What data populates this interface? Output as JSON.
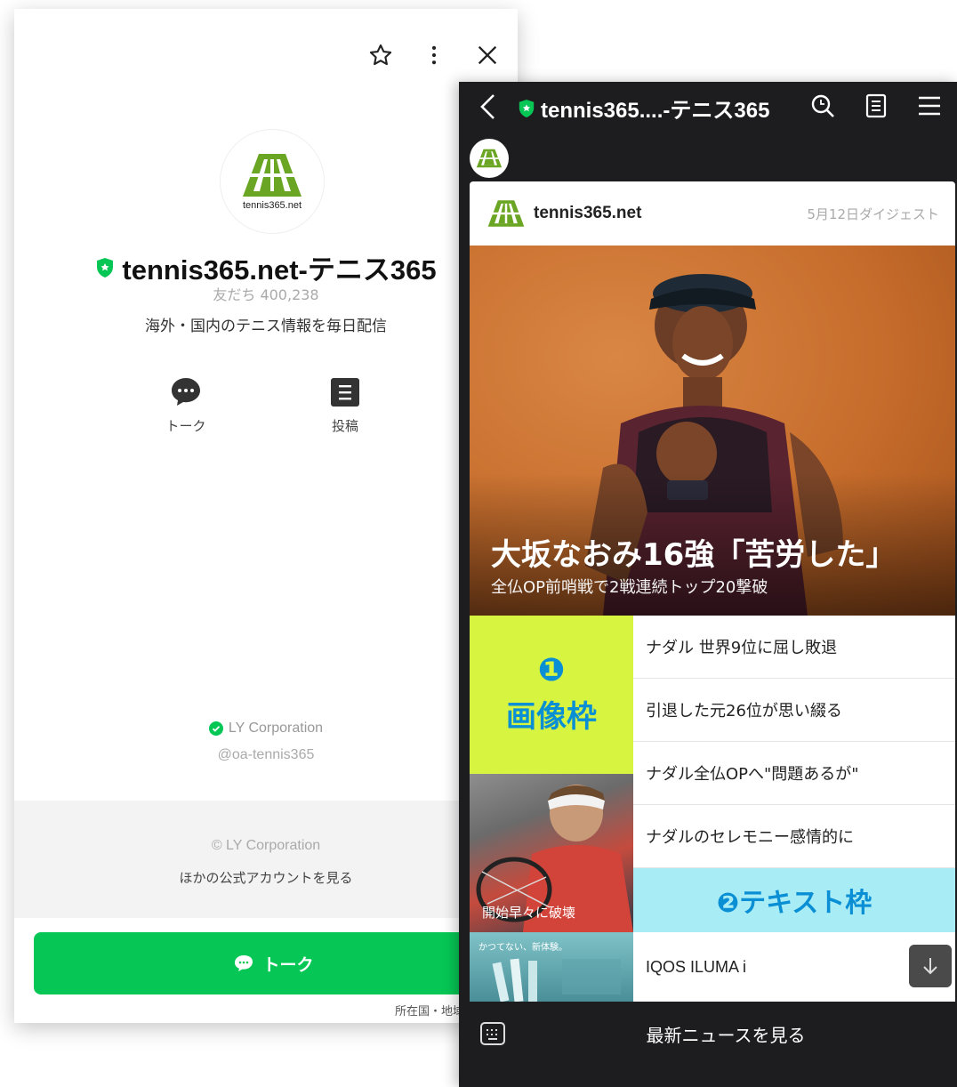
{
  "profile": {
    "logo_text": "tennis365.net",
    "name": "tennis365.net-テニス365",
    "friends": "友だち 400,238",
    "description": "海外・国内のテニス情報を毎日配信",
    "actions": [
      {
        "label": "トーク",
        "icon": "chat-bubble-icon"
      },
      {
        "label": "投稿",
        "icon": "post-list-icon"
      }
    ],
    "provider": "LY Corporation",
    "handle": "@oa-tennis365",
    "copyright": "© LY Corporation",
    "other_accounts": "ほかの公式アカウントを見る",
    "talk_button": "トーク",
    "region_link": "所在国・地域"
  },
  "chat": {
    "title": "tennis365....-テニス365",
    "digest": {
      "brand": "tennis365.net",
      "date": "5月12日ダイジェスト",
      "headline": "大坂なおみ16強「苦労した」",
      "subline": "全仏OP前哨戦で2戦連続トップ20撃破"
    },
    "image_frame": {
      "number": "❶",
      "label": "画像枠"
    },
    "text_frame": "❷テキスト枠",
    "articles": [
      "ナダル 世界9位に屈し敗退",
      "引退した元26位が思い綴る",
      "ナダル全仏OPへ\"問題あるが\"",
      "ナダルのセレモニー感情的に"
    ],
    "thumb_caption": "開始早々に破壊",
    "ad_thumb_text": "かつてない、新体験。",
    "ad_title": "IQOS ILUMA i",
    "bottom_label": "最新ニュースを見る"
  },
  "colors": {
    "line_green": "#06c755",
    "image_frame": "#d7f441",
    "text_frame": "#a8ecf6",
    "annotation_blue": "#0a8fd4"
  }
}
